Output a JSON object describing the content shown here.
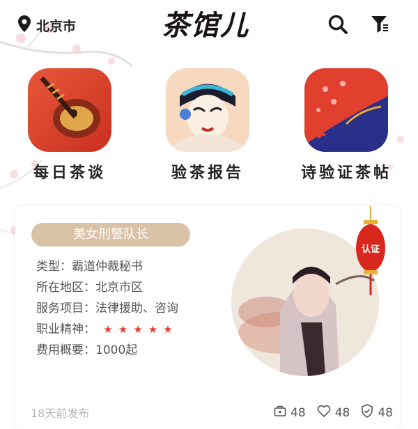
{
  "header": {
    "location": "北京市",
    "title": "茶馆儿",
    "icons": [
      "location-pin-icon",
      "search-icon",
      "filter-icon"
    ]
  },
  "categories": [
    {
      "label": "每日茶谈",
      "icon": "pipa-instrument-icon"
    },
    {
      "label": "验茶报告",
      "icon": "opera-face-icon"
    },
    {
      "label": "诗验证茶帖",
      "icon": "folding-fan-icon"
    }
  ],
  "card": {
    "title": "美女刑警队长",
    "type_label": "类型：",
    "type_value": "霸道仲裁秘书",
    "region_label": "所在地区：",
    "region_value": "北京市区",
    "service_label": "服务项目：",
    "service_value": "法律援助、咨询",
    "spirit_label": "职业精神：",
    "spirit_rating": 5,
    "fee_label": "费用概要：",
    "fee_value": "1000起",
    "lantern_text": "认证",
    "posted": "18天前发布",
    "stats": {
      "bag_count": "48",
      "like_count": "48",
      "shield_count": "48"
    }
  },
  "colors": {
    "title_pill": "#d9c2a5",
    "star": "#e63a2e",
    "lantern": "#d8281e"
  }
}
